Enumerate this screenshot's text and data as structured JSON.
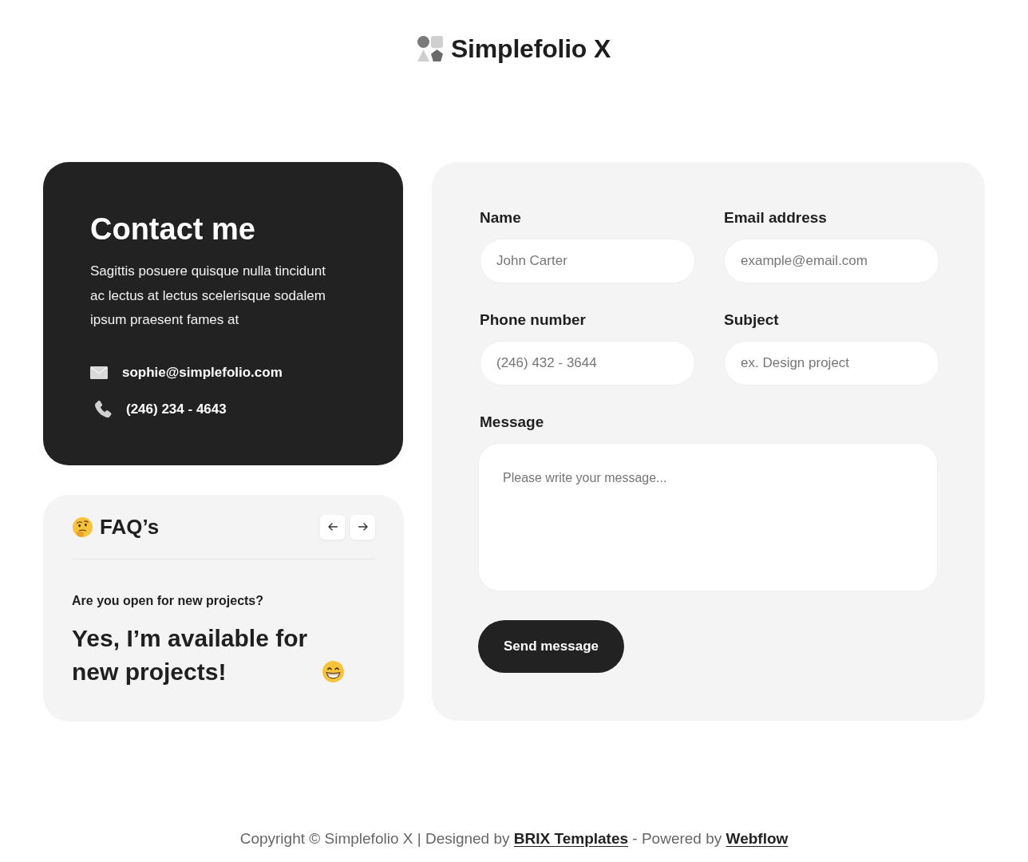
{
  "header": {
    "logo_text": "Simplefolio X"
  },
  "contact_card": {
    "title": "Contact me",
    "description": "Sagittis posuere quisque nulla tincidunt ac lectus at lectus scelerisque sodalem ipsum praesent fames at",
    "contacts": [
      {
        "kind": "email",
        "text": "sophie@simplefolio.com"
      },
      {
        "kind": "phone",
        "text": "(246) 234 - 4643"
      }
    ]
  },
  "faq": {
    "title": "FAQ’s",
    "question": "Are you open for new projects?",
    "answer": "Yes, I’m available for new projects!"
  },
  "form": {
    "fields": [
      {
        "kind": "input",
        "label": "Name",
        "placeholder": "John Carter"
      },
      {
        "kind": "input",
        "label": "Email address",
        "placeholder": "example@email.com"
      },
      {
        "kind": "input",
        "label": "Phone number",
        "placeholder": "(246) 432 - 3644"
      },
      {
        "kind": "input",
        "label": "Subject",
        "placeholder": "ex. Design project"
      },
      {
        "kind": "textarea",
        "label": "Message",
        "placeholder": "Please write your message..."
      }
    ],
    "submit": "Send message"
  },
  "footer": {
    "parts": [
      {
        "kind": "text",
        "text": "Copyright © Simplefolio X | Designed by"
      },
      {
        "kind": "link",
        "text": "BRIX Templates"
      },
      {
        "kind": "text",
        "text": "- Powered by"
      },
      {
        "kind": "link",
        "text": "Webflow"
      }
    ]
  }
}
